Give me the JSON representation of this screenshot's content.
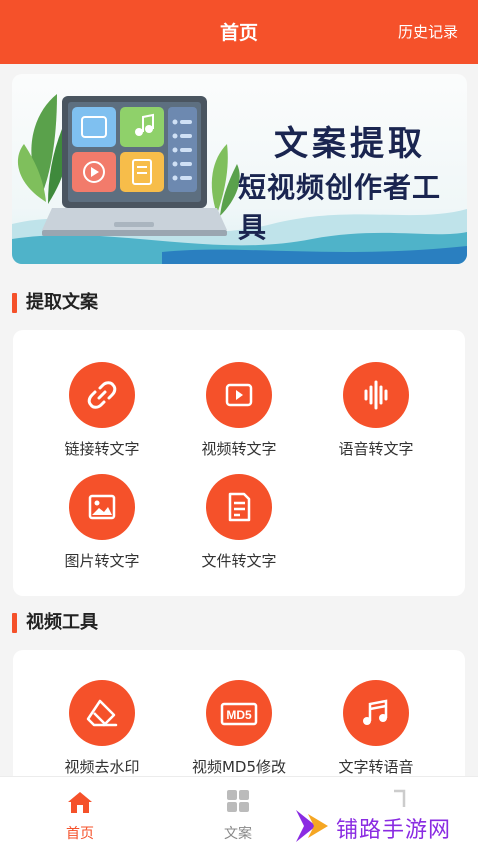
{
  "header": {
    "title": "首页",
    "history_label": "历史记录"
  },
  "banner": {
    "line1": "文案提取",
    "line2": "短视频创作者工具"
  },
  "sections": [
    {
      "title": "提取文案",
      "tools": [
        {
          "label": "链接转文字",
          "icon": "link-icon"
        },
        {
          "label": "视频转文字",
          "icon": "play-icon"
        },
        {
          "label": "语音转文字",
          "icon": "waveform-icon"
        },
        {
          "label": "图片转文字",
          "icon": "image-icon"
        },
        {
          "label": "文件转文字",
          "icon": "document-icon"
        }
      ]
    },
    {
      "title": "视频工具",
      "tools": [
        {
          "label": "视频去水印",
          "icon": "eraser-icon"
        },
        {
          "label": "视频MD5修改",
          "icon": "md5-icon"
        },
        {
          "label": "文字转语音",
          "icon": "music-note-icon"
        }
      ]
    }
  ],
  "bottom_nav": [
    {
      "label": "首页",
      "icon": "home-icon",
      "active": true
    },
    {
      "label": "文案",
      "icon": "grid-icon",
      "active": false
    }
  ],
  "watermark": {
    "text": "铺路手游网"
  },
  "md5_icon_text": "MD5",
  "colors": {
    "accent": "#f5512a",
    "background": "#f4f4f4",
    "card": "#ffffff",
    "watermark": "#8a2be2"
  }
}
